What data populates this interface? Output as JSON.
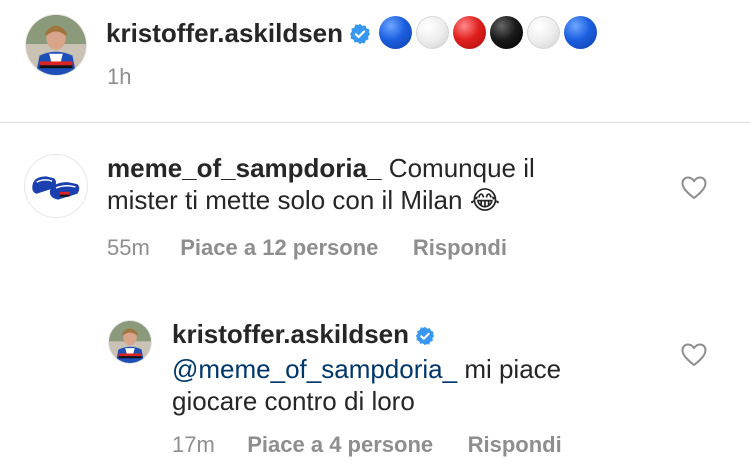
{
  "post": {
    "username": "kristoffer.askildsen",
    "time": "1h",
    "emoji_circles": [
      "blue",
      "white",
      "red",
      "black",
      "white",
      "blue"
    ]
  },
  "comments": [
    {
      "username": "meme_of_sampdoria_",
      "text_line1": "Comunque il",
      "text_line2": "mister ti mette solo con il Milan",
      "emoji": "😂",
      "time": "55m",
      "likes": "Piace a 12 persone",
      "reply": "Rispondi"
    }
  ],
  "reply": {
    "username": "kristoffer.askildsen",
    "mention": "@meme_of_sampdoria_",
    "text_line1_rest": " mi piace",
    "text_line2": "giocare contro di loro",
    "time": "17m",
    "likes": "Piace a 4 persone",
    "reply": "Rispondi"
  },
  "colors": {
    "text": "#262626",
    "secondary": "#8e8e8e",
    "verified": "#3897f0",
    "mention": "#00376b"
  },
  "icons": [
    "verified-badge-icon",
    "heart-outline-icon"
  ]
}
